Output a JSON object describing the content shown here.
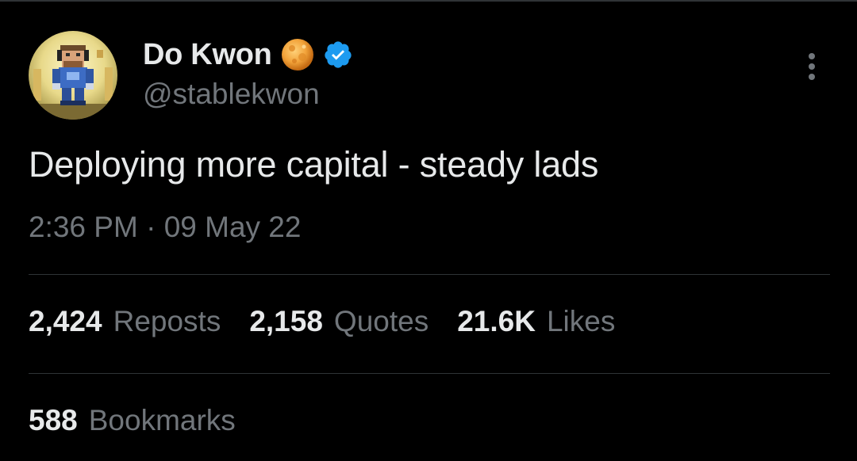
{
  "author": {
    "display_name": "Do Kwon",
    "handle": "@stablekwon",
    "avatar_icon": "pixel-art-avatar",
    "badge_icons": [
      "moon-icon",
      "verified-badge-icon"
    ],
    "verified_color": "#1d9bf0"
  },
  "tweet": {
    "text": "Deploying more capital - steady lads",
    "time": "2:36 PM",
    "separator": "·",
    "date": "09 May 22"
  },
  "stats": {
    "reposts": {
      "count": "2,424",
      "label": "Reposts"
    },
    "quotes": {
      "count": "2,158",
      "label": "Quotes"
    },
    "likes": {
      "count": "21.6K",
      "label": "Likes"
    },
    "bookmarks": {
      "count": "588",
      "label": "Bookmarks"
    }
  },
  "colors": {
    "background": "#000000",
    "text_primary": "#e7e9ea",
    "text_secondary": "#71767b",
    "divider": "#2f3336"
  }
}
